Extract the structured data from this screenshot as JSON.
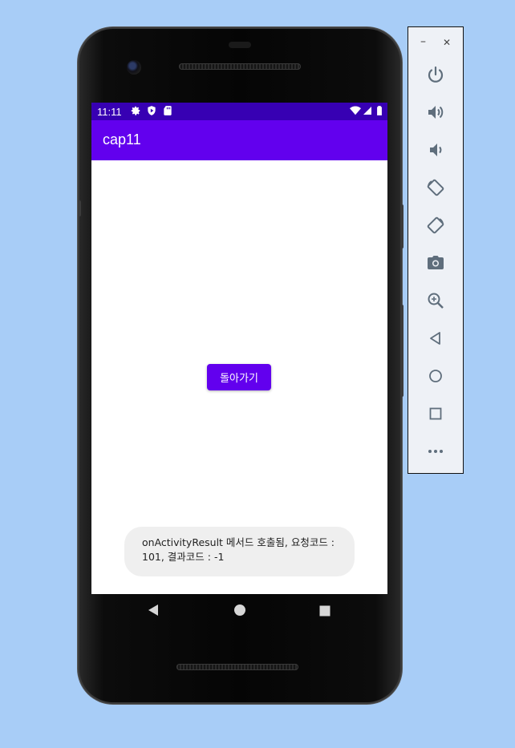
{
  "status_bar": {
    "time": "11:11"
  },
  "app_bar": {
    "title": "cap11"
  },
  "main": {
    "back_button_label": "돌아가기"
  },
  "toast": {
    "message": "onActivityResult 메서드 호출됨, 요청코드 : 101, 결과코드 : -1"
  },
  "nav_bar": {
    "icons": [
      "back-triangle-icon",
      "home-circle-icon",
      "recents-square-icon"
    ]
  },
  "emulator_panel": {
    "minimize_label": "–",
    "close_label": "✕",
    "tools": [
      "power-icon",
      "volume-up-icon",
      "volume-down-icon",
      "rotate-left-icon",
      "rotate-right-icon",
      "camera-icon",
      "zoom-icon",
      "back-icon",
      "home-icon",
      "overview-icon",
      "more-icon"
    ]
  },
  "colors": {
    "primary": "#6200ee",
    "primary_dark": "#3700b3",
    "background": "#a8cdf7"
  }
}
